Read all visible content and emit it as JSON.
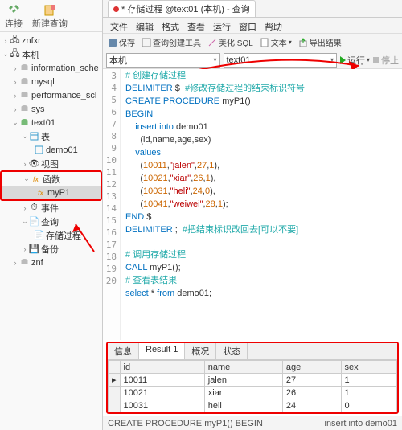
{
  "left_toolbar": {
    "connect": "连接",
    "newquery": "新建查询"
  },
  "tree": {
    "n_znfxr": "znfxr",
    "n_local": "本机",
    "n_info": "information_sche",
    "n_mysql": "mysql",
    "n_perf": "performance_scl",
    "n_sys": "sys",
    "n_text01": "text01",
    "n_tables": "表",
    "n_demo01": "demo01",
    "n_views": "视图",
    "n_func": "函数",
    "n_myp1": "myP1",
    "n_events": "事件",
    "n_query": "查询",
    "n_proc": "存储过程",
    "n_backup": "备份",
    "n_znf": "znf"
  },
  "tab": {
    "title": "* 存储过程 @text01 (本机) - 查询"
  },
  "menu": {
    "file": "文件",
    "edit": "编辑",
    "format": "格式",
    "view": "查看",
    "tools": "运行",
    "window": "窗口",
    "help": "帮助"
  },
  "tb2": {
    "save": "保存",
    "qb": "查询创建工具",
    "beaut": "美化 SQL",
    "text": "文本",
    "export": "导出结果"
  },
  "combo": {
    "left": "本机",
    "right": "text01"
  },
  "run": {
    "label": "运行",
    "stop": "停止"
  },
  "code": {
    "l3": "# 创建存储过程",
    "l4a": "DELIMITER",
    "l4b": " $  ",
    "l4c": "#修改存储过程的结束标识符号",
    "l5a": "CREATE PROCEDURE",
    "l5b": " myP1()",
    "l6": "BEGIN",
    "l7a": "    insert into",
    "l7b": " demo01",
    "l8": "      (id,name,age,sex)",
    "l9": "    values",
    "l10a": "      (",
    "l10b": "10011",
    "l10c": ",",
    "l10d": "\"jalen\"",
    "l10e": ",",
    "l10f": "27",
    "l10g": ",",
    "l10h": "1",
    "l10i": "),",
    "l11a": "      (",
    "l11b": "10021",
    "l11c": ",",
    "l11d": "\"xiar\"",
    "l11e": ",",
    "l11f": "26",
    "l11g": ",",
    "l11h": "1",
    "l11i": "),",
    "l12a": "      (",
    "l12b": "10031",
    "l12c": ",",
    "l12d": "\"heli\"",
    "l12e": ",",
    "l12f": "24",
    "l12g": ",",
    "l12h": "0",
    "l12i": "),",
    "l13a": "      (",
    "l13b": "10041",
    "l13c": ",",
    "l13d": "\"weiwei\"",
    "l13e": ",",
    "l13f": "28",
    "l13g": ",",
    "l13h": "1",
    "l13i": ");",
    "l14": "END",
    "l14b": " $",
    "l15a": "DELIMITER",
    "l15b": " ;  ",
    "l15c": "#把结束标识改回去[可以不要]",
    "l17": "# 调用存储过程",
    "l18a": "CALL",
    "l18b": " myP1();",
    "l19": "# 查看表结果",
    "l20a": "select",
    "l20b": " * ",
    "l20c": "from",
    "l20d": " demo01;"
  },
  "result_tabs": {
    "t1": "信息",
    "t2": "Result 1",
    "t3": "概况",
    "t4": "状态"
  },
  "grid": {
    "h_id": "id",
    "h_name": "name",
    "h_age": "age",
    "h_sex": "sex",
    "rows": [
      {
        "id": "10011",
        "name": "jalen",
        "age": "27",
        "sex": "1"
      },
      {
        "id": "10021",
        "name": "xiar",
        "age": "26",
        "sex": "1"
      },
      {
        "id": "10031",
        "name": "heli",
        "age": "24",
        "sex": "0"
      }
    ]
  },
  "status": {
    "left": "CREATE PROCEDURE myP1() BEGIN",
    "right": "insert into demo01"
  }
}
